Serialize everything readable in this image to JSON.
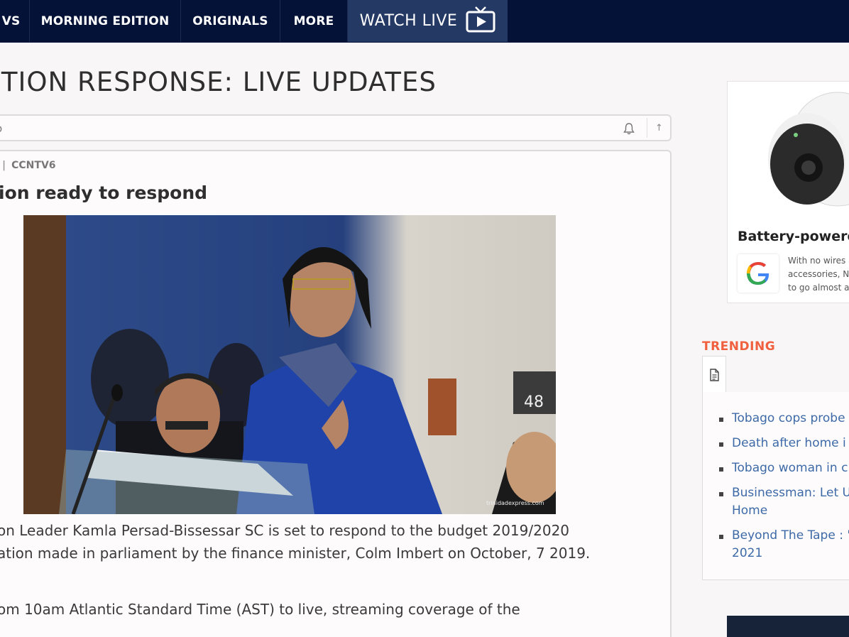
{
  "nav": {
    "items": [
      "VS",
      "MORNING EDITION",
      "ORIGINALS",
      "MORE"
    ],
    "watch_live": "WATCH LIVE"
  },
  "page": {
    "title": "ITION RESPONSE: LIVE UPDATES"
  },
  "toolbar": {
    "text": "o",
    "up_label": "↑"
  },
  "post": {
    "byline_sep": "|",
    "byline_source": "CCNTV6",
    "title": "ion ready to respond",
    "photo_credit": "trinidadexpress.com",
    "para1_line1": "on Leader Kamla Persad-Bissessar SC is set to respond to the budget 2019/2020",
    "para1_line2": "ation made in parliament by the finance minister, Colm Imbert on October, 7 2019.",
    "para2_line1": "om 10am Atlantic Standard Time (AST) to live, streaming coverage of the"
  },
  "ad": {
    "title": "Battery-powered",
    "text_line1": "With no wires a",
    "text_line2": "accessories, N",
    "text_line3": "to go almost a"
  },
  "trending": {
    "label": "TRENDING",
    "items": [
      {
        "line1": "Tobago cops probe",
        "line2": ""
      },
      {
        "line1": "Death after home i",
        "line2": ""
      },
      {
        "line1": "Tobago woman in c",
        "line2": ""
      },
      {
        "line1": "Businessman: Let U",
        "line2": "Home"
      },
      {
        "line1": "Beyond The Tape : '",
        "line2": "2021"
      }
    ]
  },
  "colors": {
    "nav_bg": "#031236",
    "watch_live_bg": "#253965",
    "trending_accent": "#f0603e",
    "link": "#3d6aa7"
  }
}
